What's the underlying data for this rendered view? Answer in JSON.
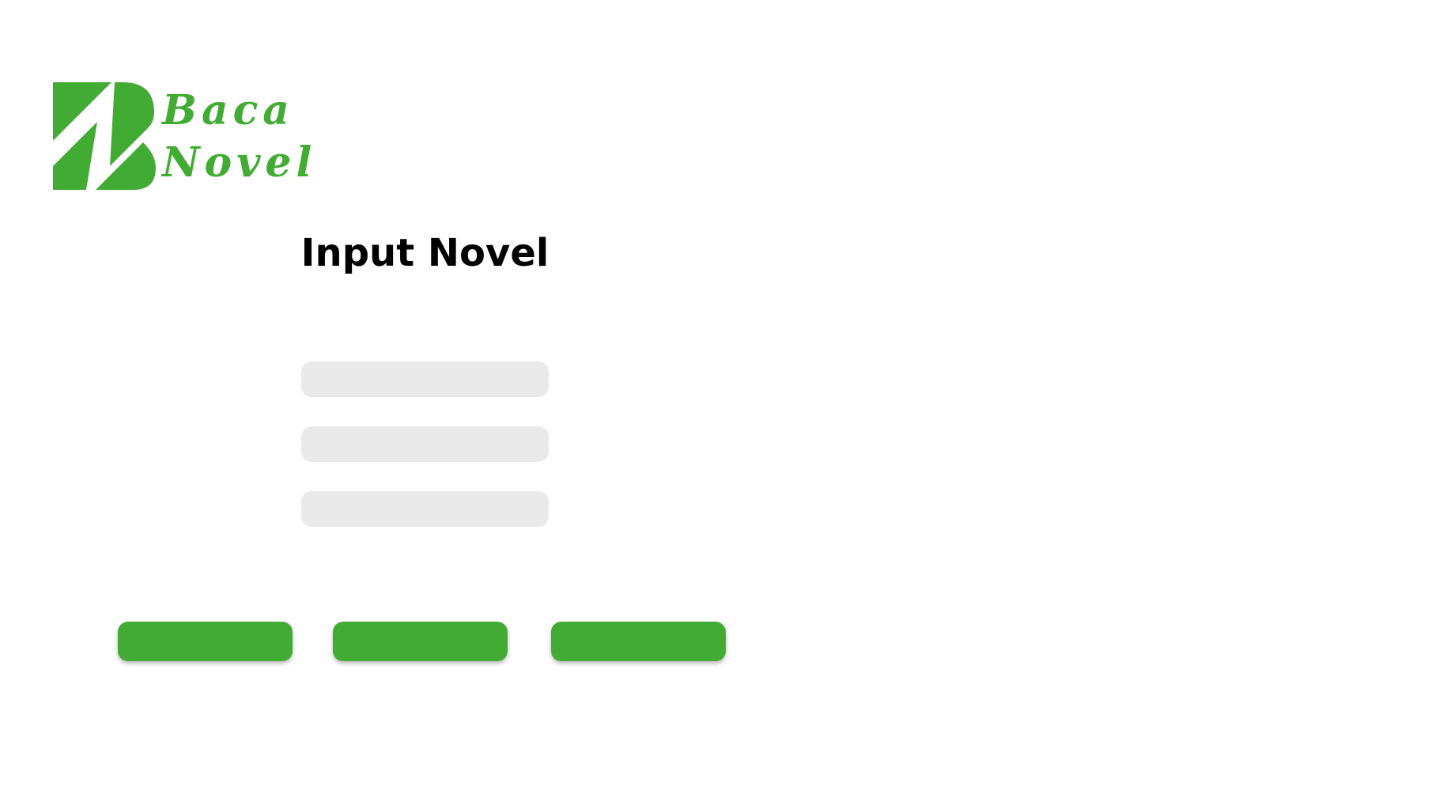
{
  "brand": {
    "logo_line1": "Baca",
    "logo_line2": "Novel",
    "accent_color": "#42ab33",
    "logo_icon": "stylized-B-logo-icon"
  },
  "page": {
    "title": "Input Novel"
  },
  "form": {
    "fields": [
      {
        "value": "",
        "placeholder": ""
      },
      {
        "value": "",
        "placeholder": ""
      },
      {
        "value": "",
        "placeholder": ""
      }
    ],
    "field_background": "#e9e9e9"
  },
  "actions": {
    "buttons": [
      {
        "label": ""
      },
      {
        "label": ""
      },
      {
        "label": ""
      }
    ],
    "button_color": "#42ab33"
  }
}
